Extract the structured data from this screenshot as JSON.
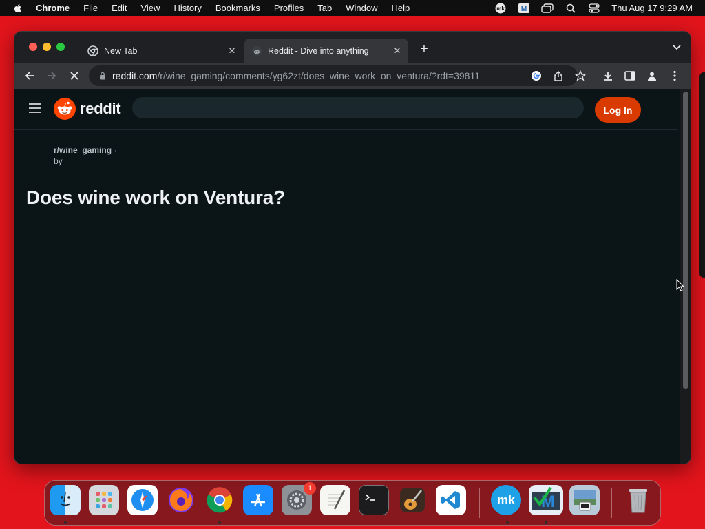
{
  "menubar": {
    "app_name": "Chrome",
    "menus": [
      "File",
      "Edit",
      "View",
      "History",
      "Bookmarks",
      "Profiles",
      "Tab",
      "Window",
      "Help"
    ],
    "clock": "Thu Aug 17  9:29 AM"
  },
  "tabs": [
    {
      "title": "New Tab",
      "icon": "chrome-icon",
      "active": false
    },
    {
      "title": "Reddit - Dive into anything",
      "icon": "reddit-favicon",
      "active": true
    }
  ],
  "toolbar": {
    "url_host": "reddit.com",
    "url_path": "/r/wine_gaming/comments/yg62zt/does_wine_work_on_ventura/?rdt=39811"
  },
  "reddit": {
    "wordmark": "reddit",
    "login_label": "Log In",
    "subreddit": "r/wine_gaming",
    "separator": "·",
    "by_label": "by",
    "post_title": "Does wine work on Ventura?",
    "search_value": ""
  },
  "dock": {
    "apps": [
      "Finder",
      "Launchpad",
      "Safari",
      "Firefox",
      "Chrome",
      "App Store",
      "System Settings",
      "TextEdit",
      "Terminal",
      "GarageBand",
      "Visual Studio Code",
      "MK",
      "Mindmap",
      "Preview",
      "Trash"
    ],
    "settings_badge": "1"
  },
  "colors": {
    "desktop": "#e3141c",
    "reddit_orange": "#ff4500",
    "login_button": "#d93a00",
    "page_bg": "#0b1416"
  }
}
